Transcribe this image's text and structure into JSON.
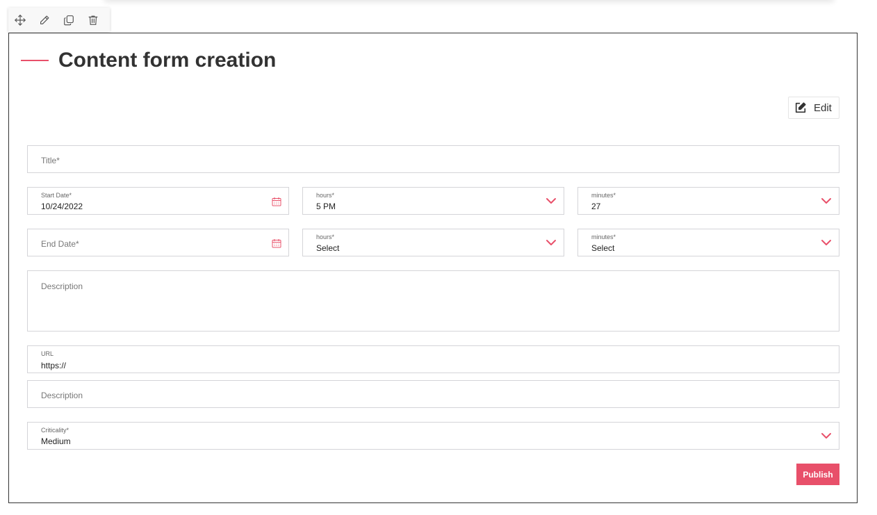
{
  "toolbar": {
    "icons": [
      "move-icon",
      "pencil-icon",
      "copy-icon",
      "trash-icon"
    ]
  },
  "page": {
    "title": "Content form creation"
  },
  "actions": {
    "edit_label": "Edit",
    "publish_label": "Publish"
  },
  "form": {
    "title_placeholder": "Title*",
    "start_date": {
      "label": "Start Date*",
      "value": "10/24/2022"
    },
    "start_hours": {
      "label": "hours*",
      "value": "5 PM"
    },
    "start_minutes": {
      "label": "minutes*",
      "value": "27"
    },
    "end_date_placeholder": "End Date*",
    "end_hours": {
      "label": "hours*",
      "value": "Select"
    },
    "end_minutes": {
      "label": "minutes*",
      "value": "Select"
    },
    "description_placeholder": "Description",
    "url": {
      "label": "URL",
      "value": "https://"
    },
    "link_description_placeholder": "Description",
    "criticality": {
      "label": "Criticality*",
      "value": "Medium"
    }
  },
  "colors": {
    "accent": "#e8506a",
    "border": "#d4d4d8"
  }
}
